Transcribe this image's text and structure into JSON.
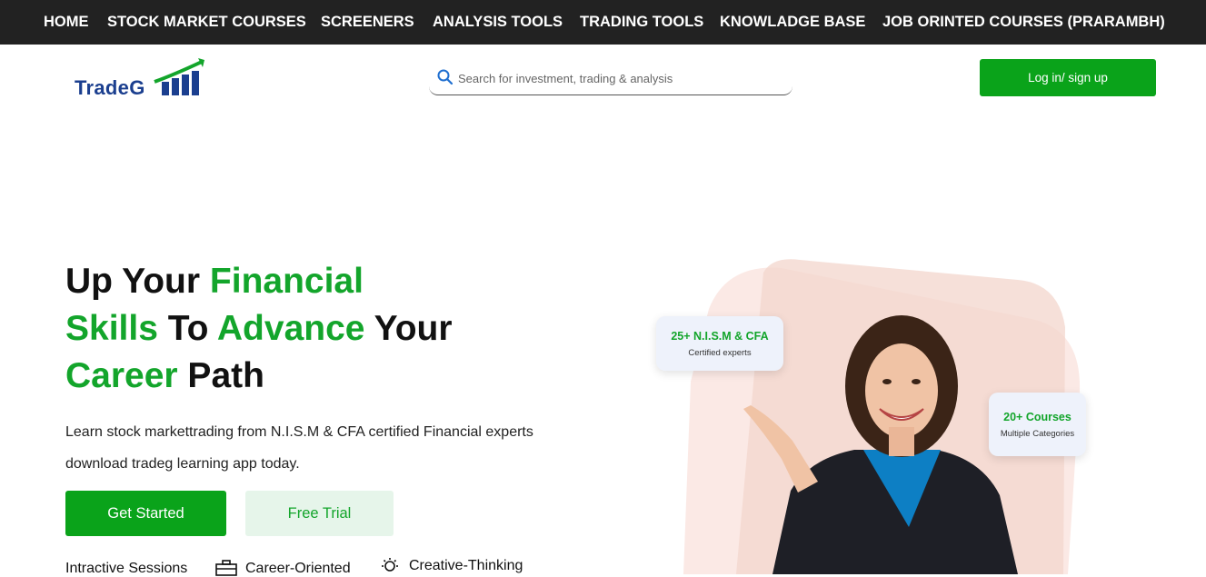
{
  "nav": {
    "items": [
      {
        "label": "HOME"
      },
      {
        "label": "STOCK MARKET COURSES"
      },
      {
        "label": "SCREENERS"
      },
      {
        "label": "ANALYSIS TOOLS"
      },
      {
        "label": "TRADING TOOLS"
      },
      {
        "label": "KNOWLADGE BASE"
      },
      {
        "label": "JOB ORINTED COURSES (PRARAMBH)"
      }
    ]
  },
  "header": {
    "logo_text": "TradeG",
    "search_placeholder": "Search for investment, trading & analysis",
    "login_label": "Log in/ sign up"
  },
  "hero": {
    "line1_a": "Up Your ",
    "line1_b": "Financial",
    "line2_a": "Skills",
    "line2_b": " To ",
    "line2_c": "Advance",
    "line2_d": " Your",
    "line3_a": "Career",
    "line3_b": " Path",
    "sub1": "Learn stock markettrading from N.I.S.M & CFA certified Financial experts",
    "sub2": "download tradeg learning app today.",
    "get_started": "Get Started",
    "free_trial": "Free Trial",
    "features": [
      "Intractive Sessions",
      "Career-Oriented",
      "Creative-Thinking"
    ]
  },
  "badges": [
    {
      "title": "25+ N.I.S.M & CFA",
      "sub": "Certified experts"
    },
    {
      "title": "20+ Courses",
      "sub": "Multiple Categories"
    }
  ],
  "colors": {
    "accent": "#0aa31a",
    "nav_bg": "#222222",
    "brand_blue": "#1b3f8f"
  }
}
